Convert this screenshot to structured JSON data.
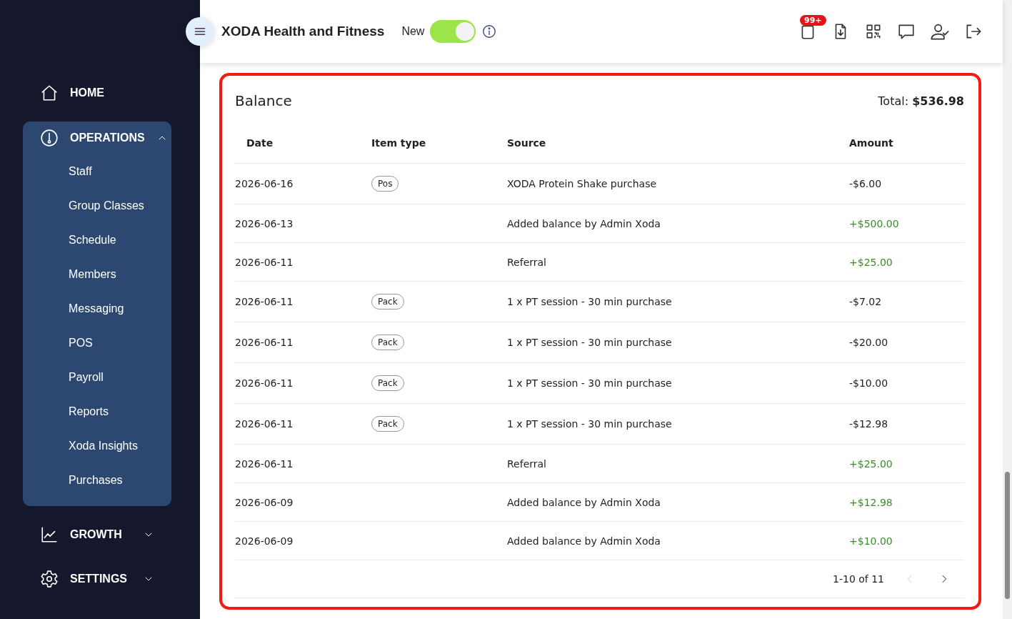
{
  "header": {
    "title": "XODA Health and Fitness",
    "new_toggle": {
      "label": "New",
      "on": true
    },
    "notification_badge": "99+"
  },
  "sidebar": {
    "items": [
      {
        "label": "HOME"
      },
      {
        "label": "OPERATIONS",
        "expanded": true,
        "children": [
          {
            "label": "Staff"
          },
          {
            "label": "Group Classes"
          },
          {
            "label": "Schedule"
          },
          {
            "label": "Members"
          },
          {
            "label": "Messaging"
          },
          {
            "label": "POS"
          },
          {
            "label": "Payroll"
          },
          {
            "label": "Reports"
          },
          {
            "label": "Xoda Insights"
          },
          {
            "label": "Purchases"
          }
        ]
      },
      {
        "label": "GROWTH",
        "expanded": false
      },
      {
        "label": "SETTINGS",
        "expanded": false
      }
    ]
  },
  "balance": {
    "title": "Balance",
    "total": "Total: **$536.98**",
    "columns": [
      "Date",
      "Item type",
      "Source",
      "Amount"
    ],
    "rows": [
      {
        "date": "2026-06-16",
        "item_type": "Pos",
        "source": "XODA Protein Shake purchase",
        "amount": "-$6.00",
        "kind": "debit"
      },
      {
        "date": "2026-06-13",
        "source": "Added balance by Admin Xoda",
        "amount": "+$500.00",
        "kind": "credit"
      },
      {
        "date": "2026-06-11",
        "source": "Referral",
        "amount": "+$25.00",
        "kind": "credit"
      },
      {
        "date": "2026-06-11",
        "item_type": "Pack",
        "source": "1 x PT session - 30 min purchase",
        "amount": "-$7.02",
        "kind": "debit"
      },
      {
        "date": "2026-06-11",
        "item_type": "Pack",
        "source": "1 x PT session - 30 min purchase",
        "amount": "-$20.00",
        "kind": "debit"
      },
      {
        "date": "2026-06-11",
        "item_type": "Pack",
        "source": "1 x PT session - 30 min purchase",
        "amount": "-$10.00",
        "kind": "debit"
      },
      {
        "date": "2026-06-11",
        "item_type": "Pack",
        "source": "1 x PT session - 30 min purchase",
        "amount": "-$12.98",
        "kind": "debit"
      },
      {
        "date": "2026-06-11",
        "source": "Referral",
        "amount": "+$25.00",
        "kind": "credit"
      },
      {
        "date": "2026-06-09",
        "source": "Added balance by Admin Xoda",
        "amount": "+$12.98",
        "kind": "credit"
      },
      {
        "date": "2026-06-09",
        "source": "Added balance by Admin Xoda",
        "amount": "+$10.00",
        "kind": "credit"
      }
    ],
    "pagination": {
      "range": "1-10 of 11",
      "prev_disabled": true,
      "next_disabled": false
    }
  }
}
